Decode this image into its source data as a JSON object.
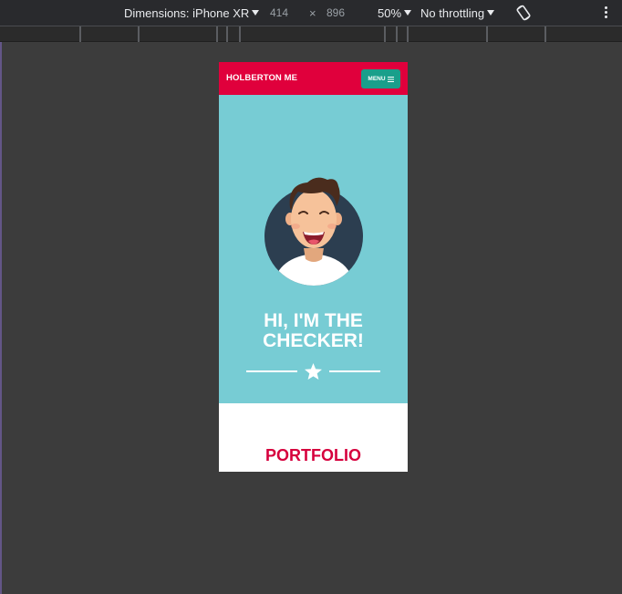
{
  "toolbar": {
    "dimensions_label": "Dimensions: iPhone XR",
    "width_value": "414",
    "times_symbol": "×",
    "height_value": "896",
    "zoom": "50%",
    "throttling": "No throttling",
    "rotate_icon": "rotate-icon",
    "more_icon": "more-options-icon"
  },
  "page": {
    "brand": "HOLBERTON ME",
    "menu_label": "MENU",
    "menu_icon": "hamburger-icon",
    "hero_title_line1": "HI, I'M THE",
    "hero_title_line2": "CHECKER!",
    "divider_icon": "star-icon",
    "section_title": "PORTFOLIO"
  },
  "colors": {
    "nav_red": "#e0003c",
    "menu_teal": "#1a9f8b",
    "hero_cyan": "#77ccd4",
    "portfolio_red": "#d6003d"
  }
}
